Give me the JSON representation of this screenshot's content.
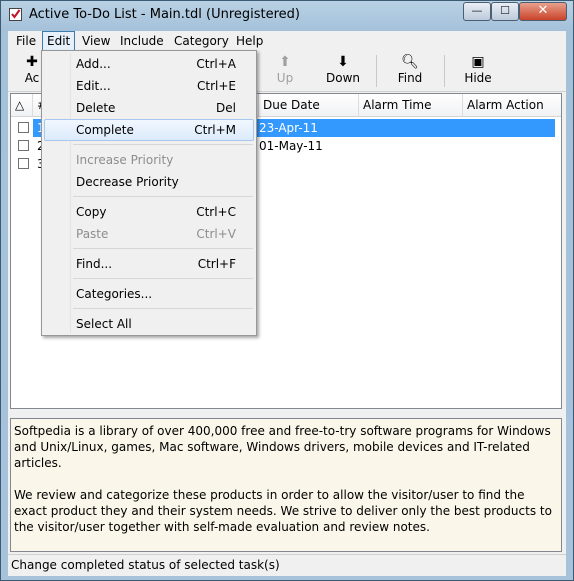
{
  "window": {
    "title": "Active To-Do List - Main.tdl (Unregistered)",
    "min_glyph": "—",
    "max_glyph": "☐",
    "close_glyph": "✕"
  },
  "menubar": {
    "items": [
      "File",
      "Edit",
      "View",
      "Include",
      "Category",
      "Help"
    ],
    "active": "Edit"
  },
  "toolbar": {
    "add_partial": "Ac",
    "up_label": "Up",
    "down_label": "Down",
    "find_label": "Find",
    "hide_label": "Hide"
  },
  "list": {
    "headers": {
      "sort": "△",
      "number": "#",
      "due_date": "Due Date",
      "alarm_time": "Alarm Time",
      "alarm_action": "Alarm Action"
    },
    "rows": [
      {
        "num": "1",
        "due": "23-Apr-11",
        "selected": true
      },
      {
        "num": "2",
        "due": "01-May-11",
        "selected": false
      },
      {
        "num": "3",
        "due": "",
        "selected": false
      }
    ]
  },
  "notes": {
    "paragraph1": "Softpedia is a library of over 400,000 free and free-to-try software programs for Windows and Unix/Linux, games, Mac software, Windows drivers, mobile devices and IT-related articles.",
    "paragraph2": "We review and categorize these products in order to allow the visitor/user to find the exact product they and their system needs. We strive to deliver only the best products to the visitor/user together with self-made evaluation and review notes."
  },
  "status": {
    "text": "Change completed status of selected task(s)"
  },
  "edit_menu": {
    "items": [
      {
        "label": "Add...",
        "shortcut": "Ctrl+A",
        "disabled": false
      },
      {
        "label": "Edit...",
        "shortcut": "Ctrl+E",
        "disabled": false
      },
      {
        "label": "Delete",
        "shortcut": "Del",
        "disabled": false
      },
      {
        "label": "Complete",
        "shortcut": "Ctrl+M",
        "disabled": false,
        "highlighted": true
      },
      {
        "label": "Increase Priority",
        "shortcut": "",
        "disabled": true
      },
      {
        "label": "Decrease Priority",
        "shortcut": "",
        "disabled": false
      },
      {
        "label": "Copy",
        "shortcut": "Ctrl+C",
        "disabled": false
      },
      {
        "label": "Paste",
        "shortcut": "Ctrl+V",
        "disabled": true
      },
      {
        "label": "Find...",
        "shortcut": "Ctrl+F",
        "disabled": false
      },
      {
        "label": "Categories...",
        "shortcut": "",
        "disabled": false
      },
      {
        "label": "Select All",
        "shortcut": "",
        "disabled": false
      }
    ]
  },
  "colors": {
    "selection": "#3399ff",
    "menu_highlight_border": "#a8c7ee",
    "notes_background": "#fbf6ea"
  }
}
